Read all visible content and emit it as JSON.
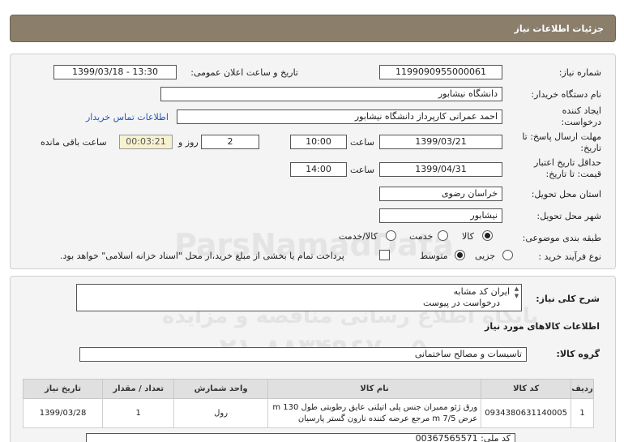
{
  "header": {
    "title": "جزئیات اطلاعات نیاز"
  },
  "fields": {
    "need_number_label": "شماره نیاز:",
    "need_number": "1199090955000061",
    "announce_label": "تاریخ و ساعت اعلان عمومی:",
    "announce_value": "1399/03/18 - 13:30",
    "buyer_label": "نام دستگاه خریدار:",
    "buyer": "دانشگاه نیشابور",
    "creator_label": "ایجاد کننده درخواست:",
    "creator": "احمد عمرانی کارپرداز دانشگاه نیشابور",
    "contact_link": "اطلاعات تماس خریدار",
    "deadline_label": "مهلت ارسال پاسخ: تا تاریخ:",
    "deadline_date": "1399/03/21",
    "time_label": "ساعت",
    "deadline_time": "10:00",
    "days": "2",
    "days_label": "روز و",
    "remaining": "00:03:21",
    "remaining_label": "ساعت باقی مانده",
    "validity_label": "حداقل تاریخ اعتبار قیمت: تا تاریخ:",
    "validity_date": "1399/04/31",
    "validity_time_label": "ساعت",
    "validity_time": "14:00",
    "province_label": "استان محل تحویل:",
    "province": "خراسان رضوی",
    "city_label": "شهر محل تحویل:",
    "city": "نیشابور",
    "category_label": "طبقه بندی موضوعی:",
    "cat_goods": "کالا",
    "cat_service": "خدمت",
    "cat_both": "کالا/خدمت",
    "process_label": "نوع فرآیند خرید :",
    "proc_partial": "جزیی",
    "proc_medium": "متوسط",
    "payment_text": "پرداخت تمام یا بخشی از مبلغ خرید،از محل \"اسناد خزانه اسلامی\" خواهد بود."
  },
  "desc": {
    "label": "شرح کلی نیاز:",
    "line1": "ایران کد مشابه",
    "line2": "درخواست در پیوست"
  },
  "items_section": {
    "title": "اطلاعات کالاهای مورد نیاز",
    "group_label": "گروه کالا:",
    "group_value": "تاسیسات و مصالح ساختمانی"
  },
  "table": {
    "headers": [
      "ردیف",
      "کد کالا",
      "نام کالا",
      "واحد شمارش",
      "تعداد / مقدار",
      "تاریخ نیاز"
    ],
    "rows": [
      {
        "row": "1",
        "code": "0934380631140005",
        "name_line1": "ورق ژئو ممبران جنس پلی اتیلنی عایق رطوبتی طول 130 m",
        "name_line2": "عرض 7/5 m مرجع عرضه کننده نارون گستر پارسیان",
        "unit": "رول",
        "qty": "1",
        "date": "1399/03/28"
      }
    ]
  },
  "footer": {
    "partial_text": "کد ملی: 00367565571"
  },
  "watermark": {
    "line1": "ParsNamadData",
    "line2": "پایگاه اطلاع رسانی مناقصه و مزایده",
    "line3": "۰۲۱-۸۸۳۴۹۶۷۰-۵"
  }
}
